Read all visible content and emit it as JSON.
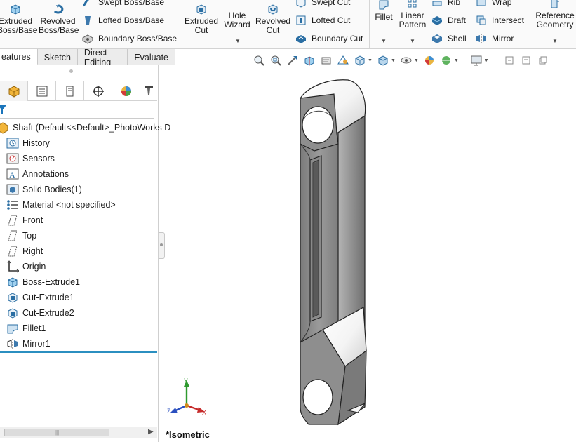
{
  "ribbon": {
    "extruded_boss": "Extruded\nBoss/Base",
    "revolved_boss": "Revolved\nBoss/Base",
    "swept_boss": "Swept Boss/Base",
    "lofted_boss": "Lofted Boss/Base",
    "boundary_boss": "Boundary Boss/Base",
    "extruded_cut": "Extruded\nCut",
    "hole_wizard": "Hole\nWizard",
    "revolved_cut": "Revolved\nCut",
    "swept_cut": "Swept Cut",
    "lofted_cut": "Lofted Cut",
    "boundary_cut": "Boundary Cut",
    "fillet": "Fillet",
    "linear_pattern": "Linear\nPattern",
    "rib": "Rib",
    "draft": "Draft",
    "shell": "Shell",
    "wrap": "Wrap",
    "intersect": "Intersect",
    "mirror": "Mirror",
    "reference_geometry": "Reference\nGeometry"
  },
  "tabs": [
    "eatures",
    "Sketch",
    "Direct Editing",
    "Evaluate"
  ],
  "tree": {
    "root": "Shaft  (Default<<Default>_PhotoWorks D",
    "items": [
      {
        "label": "History",
        "icon": "history-icon"
      },
      {
        "label": "Sensors",
        "icon": "sensors-icon"
      },
      {
        "label": "Annotations",
        "icon": "annotations-icon"
      },
      {
        "label": "Solid Bodies(1)",
        "icon": "solid-bodies-icon"
      },
      {
        "label": "Material <not specified>",
        "icon": "material-icon"
      },
      {
        "label": "Front",
        "icon": "plane-icon"
      },
      {
        "label": "Top",
        "icon": "plane-icon"
      },
      {
        "label": "Right",
        "icon": "plane-icon"
      },
      {
        "label": "Origin",
        "icon": "origin-icon"
      },
      {
        "label": "Boss-Extrude1",
        "icon": "boss-extrude-icon"
      },
      {
        "label": "Cut-Extrude1",
        "icon": "cut-extrude-icon"
      },
      {
        "label": "Cut-Extrude2",
        "icon": "cut-extrude-icon"
      },
      {
        "label": "Fillet1",
        "icon": "fillet-icon"
      },
      {
        "label": "Mirror1",
        "icon": "mirror-icon"
      }
    ]
  },
  "triad": {
    "x": "X",
    "y": "Y",
    "z": "Z"
  },
  "view_label": "*Isometric",
  "colors": {
    "accent": "#2b8fc0",
    "part": "#8c8c8c"
  }
}
